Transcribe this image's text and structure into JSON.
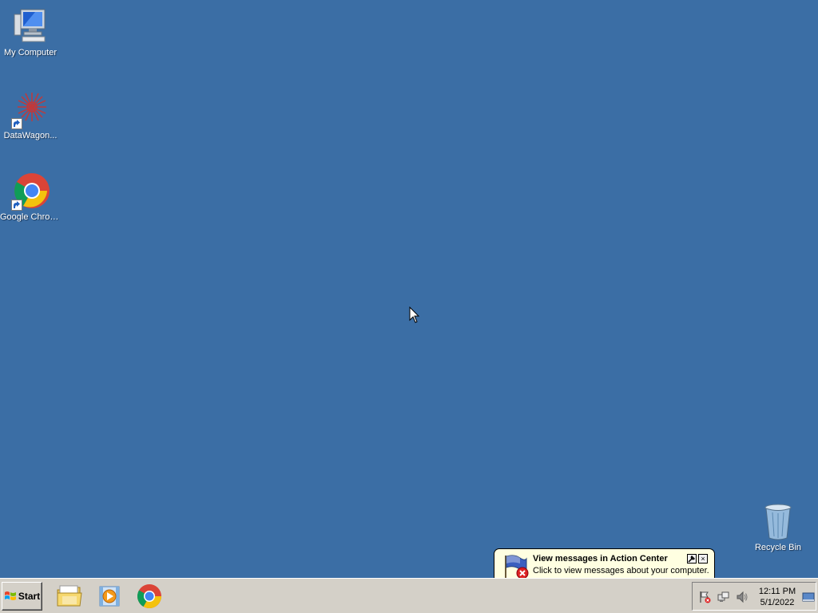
{
  "desktop": {
    "icons": [
      {
        "label": "My Computer"
      },
      {
        "label": "DataWagon..."
      },
      {
        "label": "Google Chrome"
      },
      {
        "label": "Recycle Bin"
      }
    ]
  },
  "taskbar": {
    "start_label": "Start",
    "pinned": [
      "file-explorer-icon",
      "media-player-icon",
      "chrome-icon"
    ]
  },
  "tray": {
    "time": "12:11 PM",
    "date": "5/1/2022"
  },
  "balloon": {
    "title": "View messages in Action Center",
    "text": "Click to view messages about your computer.",
    "close_glyph": "×"
  },
  "colors": {
    "desktop": "#3b6ea5",
    "taskbar": "#d4d0c8",
    "balloon": "#ffffe1"
  }
}
